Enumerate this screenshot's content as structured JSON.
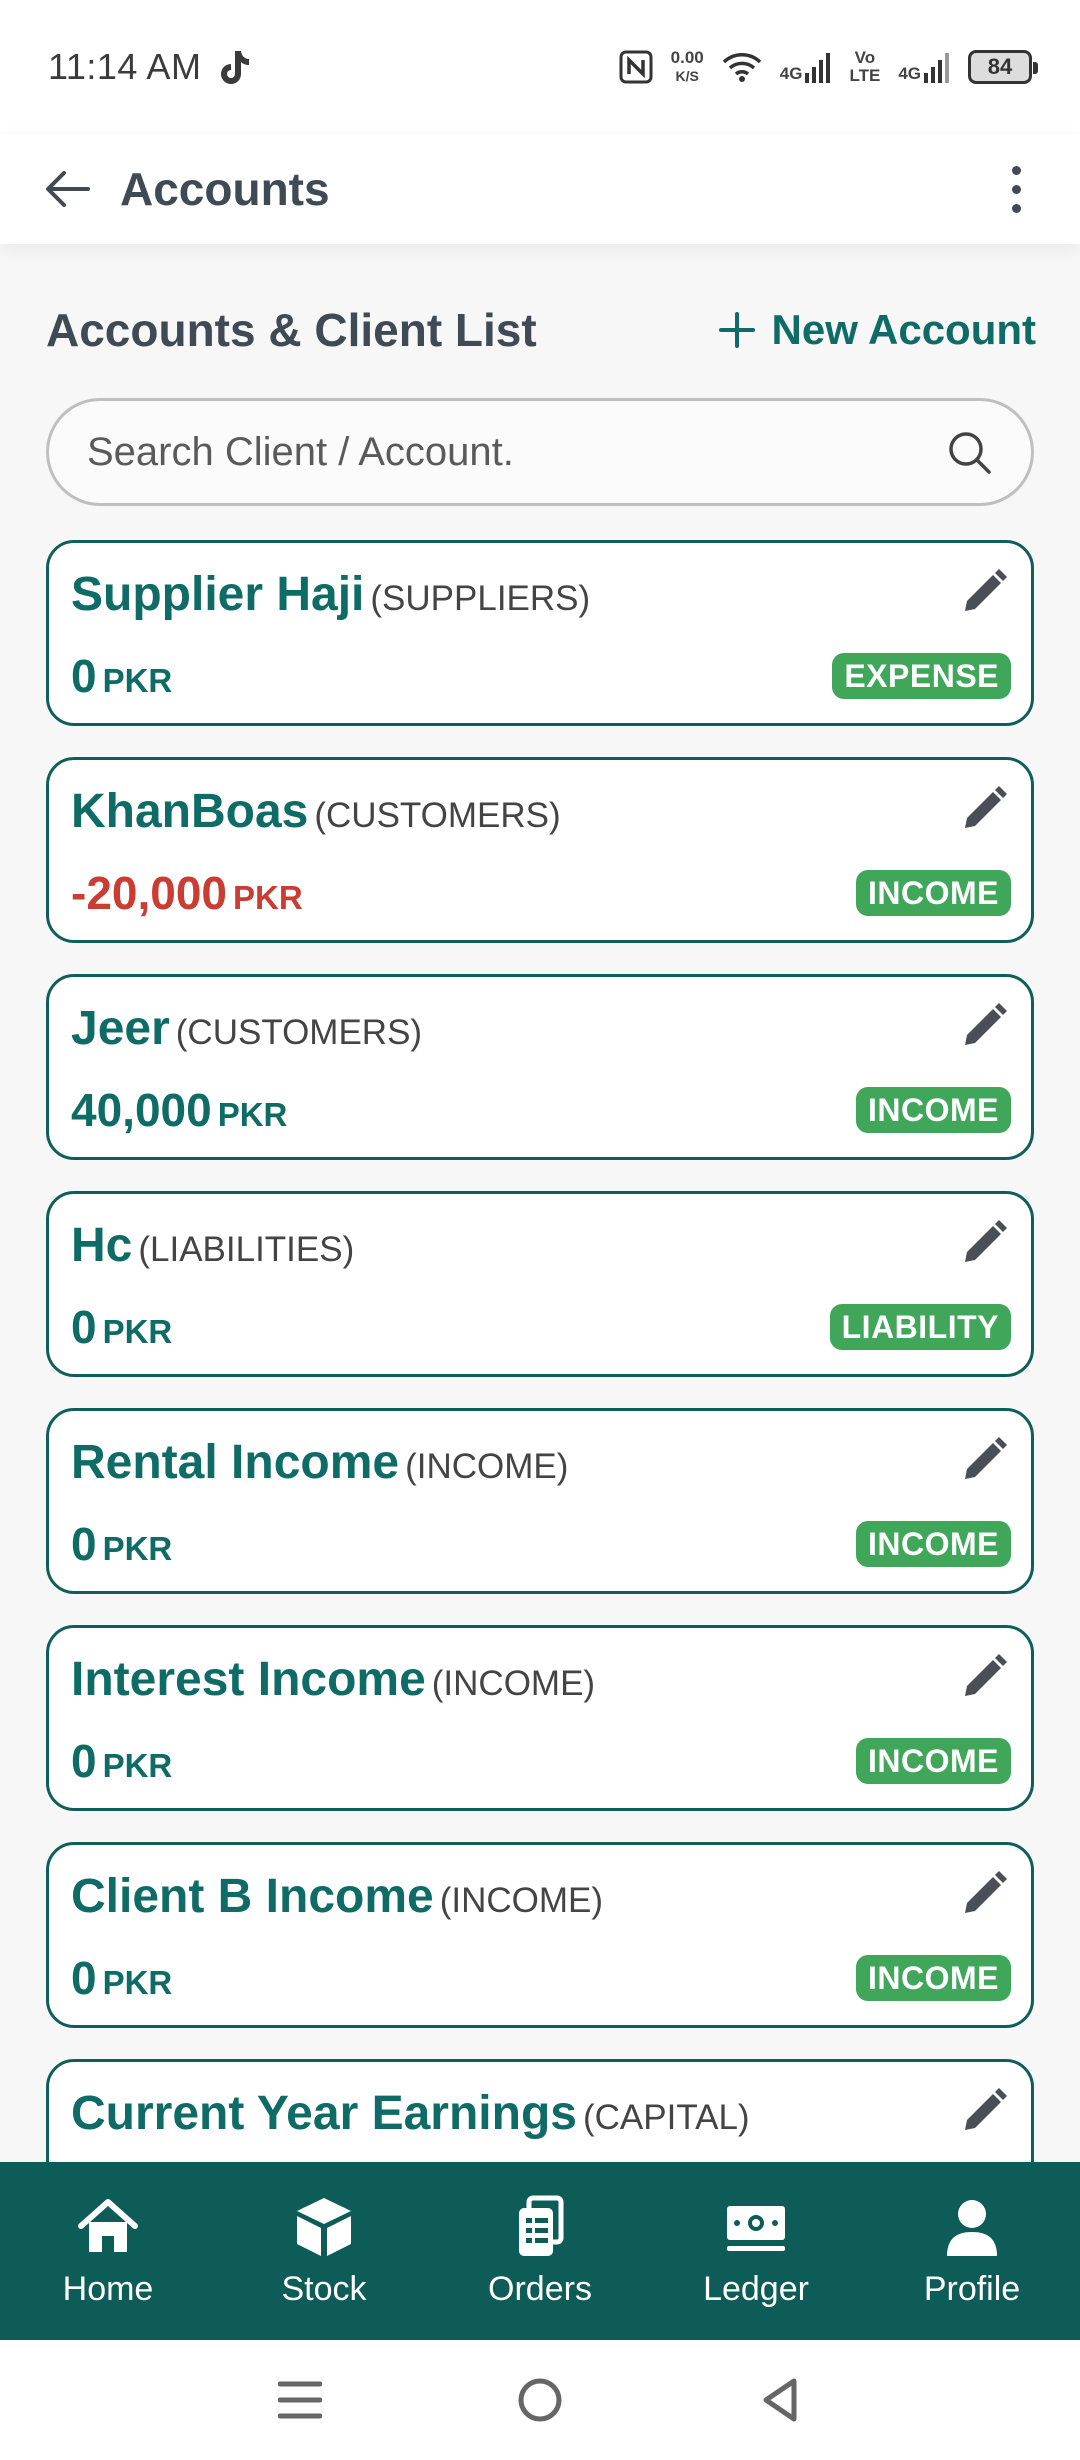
{
  "status_bar": {
    "time": "11:14 AM",
    "net_speed": "0.00",
    "net_unit": "K/S",
    "signal1": "4G",
    "volte_top": "Vo",
    "volte_bottom": "LTE",
    "signal2": "4G",
    "battery": "84"
  },
  "app_bar": {
    "title": "Accounts"
  },
  "section": {
    "title": "Accounts & Client List",
    "new_account_label": "New Account"
  },
  "search": {
    "placeholder": "Search Client / Account."
  },
  "accounts": [
    {
      "name": "Supplier Haji",
      "group": "(SUPPLIERS)",
      "amount": "0",
      "currency": "PKR",
      "badge": "EXPENSE"
    },
    {
      "name": "KhanBoas",
      "group": "(CUSTOMERS)",
      "amount": "-20,000",
      "currency": "PKR",
      "badge": "INCOME"
    },
    {
      "name": "Jeer",
      "group": "(CUSTOMERS)",
      "amount": "40,000",
      "currency": "PKR",
      "badge": "INCOME"
    },
    {
      "name": "Hc",
      "group": "(LIABILITIES)",
      "amount": "0",
      "currency": "PKR",
      "badge": "LIABILITY"
    },
    {
      "name": "Rental Income",
      "group": "(INCOME)",
      "amount": "0",
      "currency": "PKR",
      "badge": "INCOME"
    },
    {
      "name": "Interest Income",
      "group": "(INCOME)",
      "amount": "0",
      "currency": "PKR",
      "badge": "INCOME"
    },
    {
      "name": "Client B Income",
      "group": "(INCOME)",
      "amount": "0",
      "currency": "PKR",
      "badge": "INCOME"
    },
    {
      "name": "Current Year Earnings",
      "group": "(CAPITAL)"
    }
  ],
  "bottom_nav": [
    {
      "label": "Home",
      "icon": "home-icon"
    },
    {
      "label": "Stock",
      "icon": "box-icon"
    },
    {
      "label": "Orders",
      "icon": "clipboard-icon"
    },
    {
      "label": "Ledger",
      "icon": "cash-icon"
    },
    {
      "label": "Profile",
      "icon": "person-icon"
    }
  ],
  "colors": {
    "brand": "#0f6b66",
    "nav_background": "#0d5c57",
    "badge": "#3fa65a",
    "negative": "#c93d32"
  }
}
